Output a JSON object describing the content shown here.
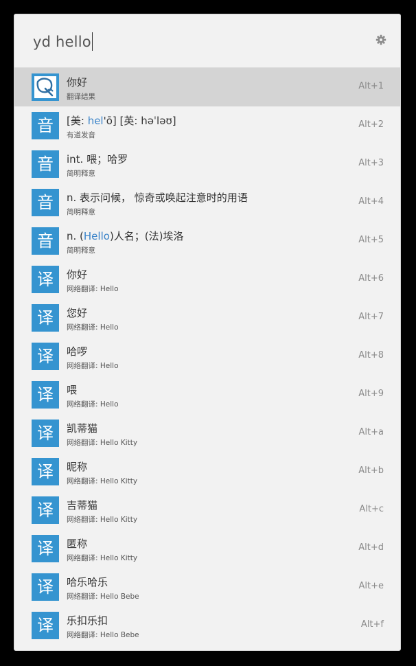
{
  "query": {
    "text": "yd hello"
  },
  "settings_icon": "gear-icon",
  "colors": {
    "background": "#000000",
    "window": "#f2f2f2",
    "selected_row": "#d4d4d4",
    "icon_tile": "#3594d0",
    "highlight_text": "#3a83c9"
  },
  "results": [
    {
      "icon": "youdao-translate-icon",
      "title_parts": [
        "你好"
      ],
      "subtitle": "翻译结果",
      "shortcut": "Alt+1",
      "selected": true
    },
    {
      "icon": "音",
      "title_parts": [
        "[美: ",
        "hel",
        "'ō] [英: həˈləʊ]"
      ],
      "subtitle": "有道发音",
      "shortcut": "Alt+2"
    },
    {
      "icon": "音",
      "title_parts": [
        "int. 喂；哈罗"
      ],
      "subtitle": "简明释意",
      "shortcut": "Alt+3"
    },
    {
      "icon": "音",
      "title_parts": [
        "n. 表示问候， 惊奇或唤起注意时的用语"
      ],
      "subtitle": "简明释意",
      "shortcut": "Alt+4"
    },
    {
      "icon": "音",
      "title_parts": [
        "n. (",
        "Hello",
        ")人名；(法)埃洛"
      ],
      "subtitle": "简明释意",
      "shortcut": "Alt+5"
    },
    {
      "icon": "译",
      "title_parts": [
        "你好"
      ],
      "subtitle": "网络翻译: Hello",
      "shortcut": "Alt+6"
    },
    {
      "icon": "译",
      "title_parts": [
        "您好"
      ],
      "subtitle": "网络翻译: Hello",
      "shortcut": "Alt+7"
    },
    {
      "icon": "译",
      "title_parts": [
        "哈啰"
      ],
      "subtitle": "网络翻译: Hello",
      "shortcut": "Alt+8"
    },
    {
      "icon": "译",
      "title_parts": [
        "喂"
      ],
      "subtitle": "网络翻译: Hello",
      "shortcut": "Alt+9"
    },
    {
      "icon": "译",
      "title_parts": [
        "凯蒂猫"
      ],
      "subtitle": "网络翻译: Hello Kitty",
      "shortcut": "Alt+a"
    },
    {
      "icon": "译",
      "title_parts": [
        "昵称"
      ],
      "subtitle": "网络翻译: Hello Kitty",
      "shortcut": "Alt+b"
    },
    {
      "icon": "译",
      "title_parts": [
        "吉蒂猫"
      ],
      "subtitle": "网络翻译: Hello Kitty",
      "shortcut": "Alt+c"
    },
    {
      "icon": "译",
      "title_parts": [
        "匿称"
      ],
      "subtitle": "网络翻译: Hello Kitty",
      "shortcut": "Alt+d"
    },
    {
      "icon": "译",
      "title_parts": [
        "哈乐哈乐"
      ],
      "subtitle": "网络翻译: Hello Bebe",
      "shortcut": "Alt+e"
    },
    {
      "icon": "译",
      "title_parts": [
        "乐扣乐扣"
      ],
      "subtitle": "网络翻译: Hello Bebe",
      "shortcut": "Alt+f"
    }
  ]
}
